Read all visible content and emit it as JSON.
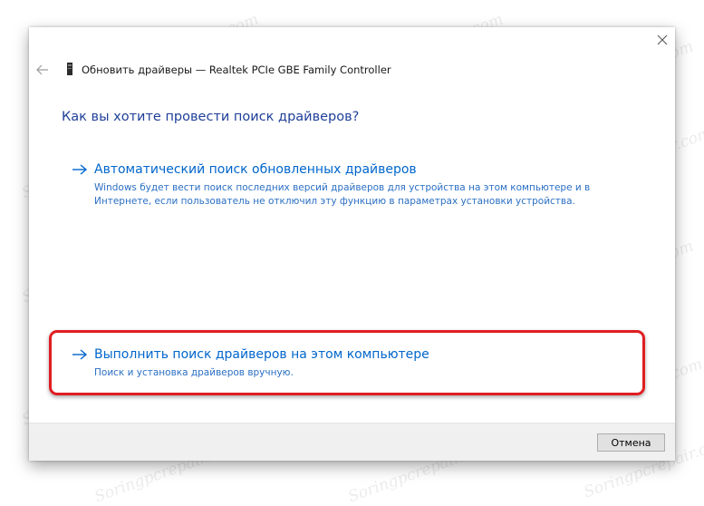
{
  "window": {
    "title": "Обновить драйверы — Realtek PCIe GBE Family Controller",
    "close_icon": "close-icon",
    "back_icon": "back-arrow-icon",
    "device_icon": "network-adapter-icon"
  },
  "main": {
    "heading": "Как вы хотите провести поиск драйверов?",
    "options": [
      {
        "title": "Автоматический поиск обновленных драйверов",
        "description": "Windows будет вести поиск последних версий драйверов для устройства на этом компьютере и в Интернете, если пользователь не отключил эту функцию в параметрах установки устройства.",
        "icon": "arrow-right-icon"
      },
      {
        "title": "Выполнить поиск драйверов на этом компьютере",
        "description": "Поиск и установка драйверов вручную.",
        "icon": "arrow-right-icon"
      }
    ]
  },
  "footer": {
    "cancel_label": "Отмена"
  },
  "watermark": {
    "text": "Soringpcrepair.com"
  },
  "colors": {
    "heading": "#1f3f99",
    "link": "#0066cc",
    "highlight": "#e01e22",
    "footer_bg": "#f0f0f0"
  }
}
